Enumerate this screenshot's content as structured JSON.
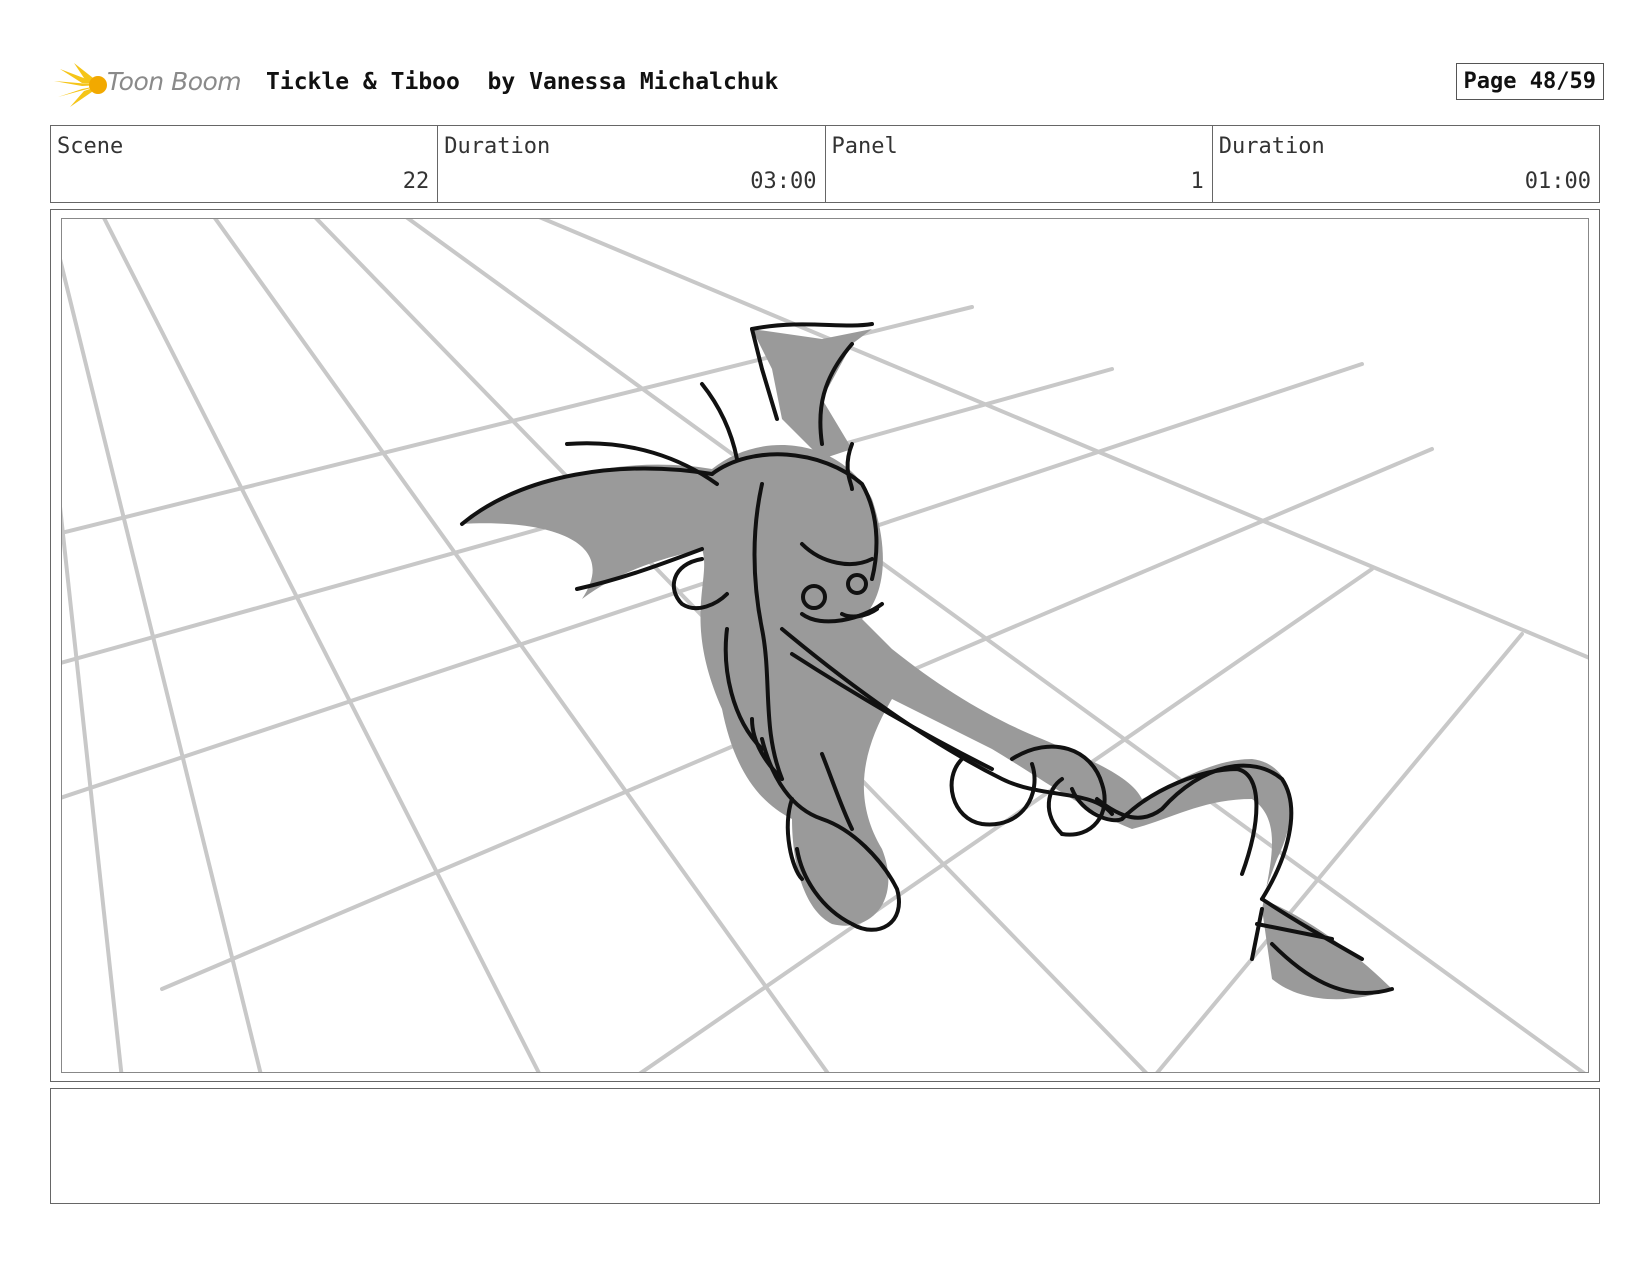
{
  "header": {
    "logo_text": "Toon Boom",
    "title": "Tickle & Tiboo  by Vanessa Michalchuk",
    "page": "Page 48/59"
  },
  "info": {
    "scene_label": "Scene",
    "scene_value": "22",
    "scene_duration_label": "Duration",
    "scene_duration_value": "03:00",
    "panel_label": "Panel",
    "panel_value": "1",
    "panel_duration_label": "Duration",
    "panel_duration_value": "01:00"
  },
  "panel": {
    "image": "storyboard-sketch",
    "colors": {
      "grid": "#c8c8c8",
      "fill": "#9a9a9a",
      "ink": "#111111"
    }
  },
  "notes": {
    "text": ""
  }
}
